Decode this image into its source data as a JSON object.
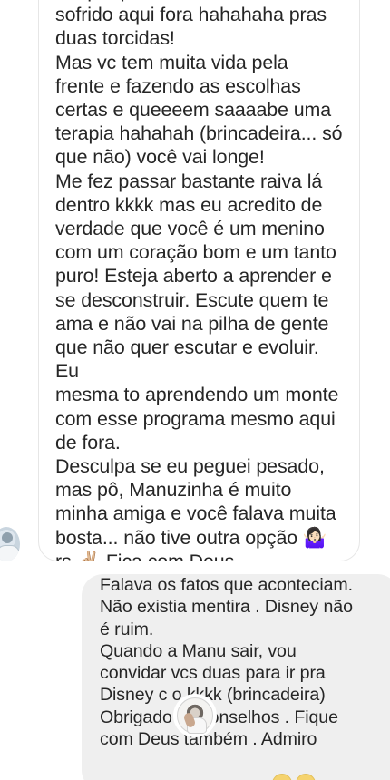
{
  "chat": {
    "incoming_message": "Foi por pouco mesmo! Foi\nsofrido aqui fora hahahaha pras\nduas torcidas!\nMas vc tem muita vida pela\nfrente e fazendo as escolhas\ncertas e queeeem saaaabe uma\nterapia hahahah (brincadeira... só\nque não) você vai longe!\nMe fez passar bastante raiva lá\ndentro kkkk mas eu acredito de\nverdade que você é um menino\ncom um coração bom e um tanto\npuro! Esteja aberto a aprender e\nse desconstruir. Escute quem te\nama e não vai na pilha de gente\nque não quer escutar e evoluir. Eu\nmesma to aprendendo um monte\ncom esse programa mesmo aqui\nde fora.\nDesculpa se eu peguei pesado,\nmas pô, Manuzinha é muito\nminha amiga e você falava muita\nbosta... não tive outra opção 🤷🏻‍♀️\nrs ✌🏼 Fica com Deus",
    "outgoing_message": "Falava os fatos que aconteciam.\nNão existia mentira .  Disney não\né  ruim.\nQuando a Manu sair, vou\nconvidar vcs duas para ir pra\nDisney c      o kkkk (brincadeira)\nObrigado      os conselhos . Fique\ncom Deus também . Admiro",
    "incoming_avatar_icon": "profile-avatar-icon",
    "reply_avatar_icon": "reply-avatar-icon",
    "emoji_icons": [
      "smiling-emoji-icon",
      "smiling-emoji-icon"
    ]
  }
}
